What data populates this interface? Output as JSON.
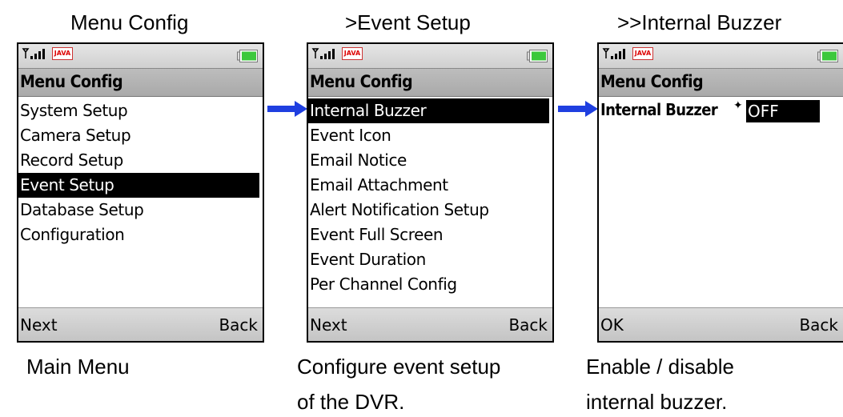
{
  "screens": [
    {
      "caption": "Menu Config",
      "title": "Menu Config",
      "menu": [
        "System Setup",
        "Camera Setup",
        "Record Setup",
        "Event Setup",
        "Database Setup",
        "Configuration"
      ],
      "selected_index": 3,
      "softkeys": {
        "left": "Next",
        "right": "Back"
      },
      "description": [
        "Main Menu"
      ]
    },
    {
      "caption": ">Event Setup",
      "title": "Menu Config",
      "menu": [
        "Internal Buzzer",
        "Event Icon",
        "Email Notice",
        "Email Attachment",
        "Alert Notification Setup",
        "Event Full Screen",
        "Event Duration",
        "Per Channel Config"
      ],
      "selected_index": 0,
      "softkeys": {
        "left": "Next",
        "right": "Back"
      },
      "description": [
        "Configure event setup",
        "of the DVR."
      ]
    },
    {
      "caption": ">>Internal Buzzer",
      "title": "Menu Config",
      "field": {
        "label": "Internal Buzzer",
        "value": "OFF"
      },
      "softkeys": {
        "left": "OK",
        "right": "Back"
      },
      "description": [
        "Enable / disable",
        "internal buzzer."
      ]
    }
  ],
  "status_bar": {
    "java_label": "JAVA",
    "signal_icon": "signal-icon",
    "battery_icon": "battery-icon"
  },
  "colors": {
    "arrow": "#1f3fe0",
    "selection": "#000000",
    "battery": "#3cc83c"
  }
}
